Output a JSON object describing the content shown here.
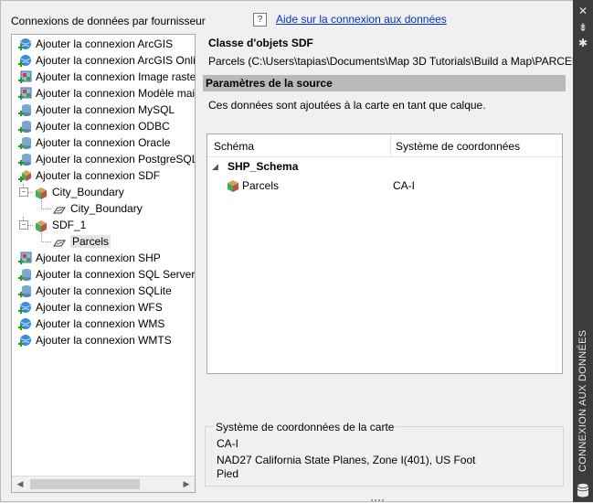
{
  "panel": {
    "providers_title": "Connexions de données par fournisseur",
    "help_link": "Aide sur la connexion aux données",
    "help_icon_glyph": "?"
  },
  "tree": {
    "items": [
      {
        "label": "Ajouter la connexion ArcGIS",
        "icon": "globe-add-icon",
        "indent": 0
      },
      {
        "label": "Ajouter la connexion ArcGIS Online",
        "icon": "globe-add-icon",
        "indent": 0
      },
      {
        "label": "Ajouter la connexion Image raster",
        "icon": "raster-add-icon",
        "indent": 0
      },
      {
        "label": "Ajouter la connexion Modèle maillé",
        "icon": "raster-add-icon",
        "indent": 0
      },
      {
        "label": "Ajouter la connexion MySQL",
        "icon": "database-add-icon",
        "indent": 0
      },
      {
        "label": "Ajouter la connexion ODBC",
        "icon": "database-add-icon",
        "indent": 0
      },
      {
        "label": "Ajouter la connexion Oracle",
        "icon": "database-add-icon",
        "indent": 0
      },
      {
        "label": "Ajouter la connexion PostgreSQL",
        "icon": "database-add-icon",
        "indent": 0
      },
      {
        "label": "Ajouter la connexion SDF",
        "icon": "sdf-add-icon",
        "indent": 0
      },
      {
        "label": "City_Boundary",
        "icon": "sdf-cube-icon",
        "indent": 1
      },
      {
        "label": "City_Boundary",
        "icon": "feature-class-icon",
        "indent": 2
      },
      {
        "label": "SDF_1",
        "icon": "sdf-cube-icon",
        "indent": 1
      },
      {
        "label": "Parcels",
        "icon": "feature-class-icon",
        "indent": 2,
        "selected": true
      },
      {
        "label": "Ajouter la connexion SHP",
        "icon": "raster-add-icon",
        "indent": 0
      },
      {
        "label": "Ajouter la connexion SQL Server",
        "icon": "database-add-icon",
        "indent": 0
      },
      {
        "label": "Ajouter la connexion SQLite",
        "icon": "database-add-icon",
        "indent": 0
      },
      {
        "label": "Ajouter la connexion WFS",
        "icon": "globe-add-icon",
        "indent": 0
      },
      {
        "label": "Ajouter la connexion WMS",
        "icon": "globe-add-icon",
        "indent": 0
      },
      {
        "label": "Ajouter la connexion WMTS",
        "icon": "globe-add-icon",
        "indent": 0
      }
    ]
  },
  "details": {
    "class_title": "Classe d'objets SDF",
    "class_path": "Parcels (C:\\Users\\tapias\\Documents\\Map 3D Tutorials\\Build a Map\\PARCELS.",
    "section_title": "Paramètres de la source",
    "source_desc": "Ces données sont ajoutées à la carte en tant que calque.",
    "grid": {
      "col_schema": "Schéma",
      "col_coord": "Système de coordonnées",
      "group_name": "SHP_Schema",
      "row_name": "Parcels",
      "row_coord": "CA-I"
    },
    "map_cs": {
      "title": "Système de coordonnées de la carte",
      "code": "CA-I",
      "description_line1": "NAD27 California State Planes, Zone I(401), US Foot",
      "description_line2": "Pied"
    }
  },
  "side_bar": {
    "title": "CONNEXION AUX DONNÉES",
    "close_glyph": "✕",
    "pin_glyph": "⇟",
    "settings_glyph": "✱"
  },
  "colors": {
    "link": "#0033cc",
    "section_bar": "#b9b9b9",
    "sidebar": "#3c3c3c"
  }
}
